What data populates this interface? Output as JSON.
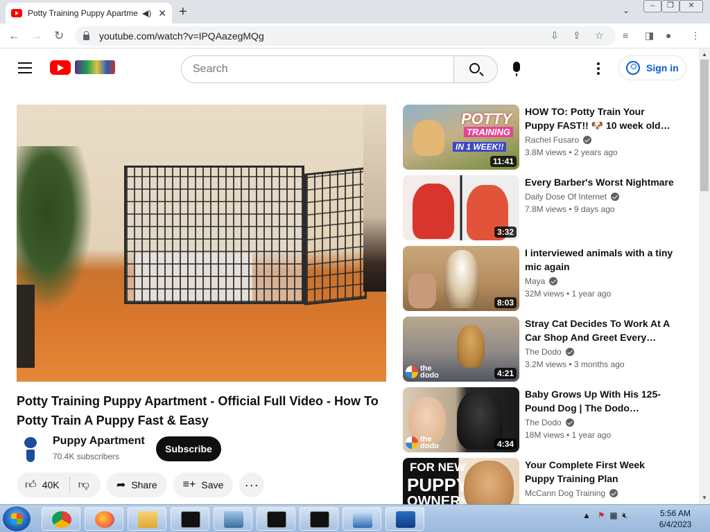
{
  "browser": {
    "tab_title": "Potty Training Puppy Apartment",
    "url": "youtube.com/watch?v=IPQAazegMQg"
  },
  "header": {
    "search_placeholder": "Search",
    "signin_label": "Sign in"
  },
  "video": {
    "title": "Potty Training Puppy Apartment - Official Full Video - How To Potty Train A Puppy Fast & Easy",
    "channel": "Puppy Apartment",
    "subscribers": "70.4K subscribers",
    "subscribe_label": "Subscribe",
    "likes": "40K",
    "share_label": "Share",
    "save_label": "Save"
  },
  "recommendations": [
    {
      "title": "HOW TO: Potty Train Your Puppy FAST!! 🐶 10 week old…",
      "channel": "Rachel Fusaro",
      "meta": "3.8M views • 2 years ago",
      "duration": "11:41",
      "thumb_caption_1": "POTTY",
      "thumb_caption_2": "TRAINING",
      "thumb_caption_3": "IN 1 WEEK!!"
    },
    {
      "title": "Every Barber's Worst Nightmare",
      "channel": "Daily Dose Of Internet",
      "meta": "7.8M views • 9 days ago",
      "duration": "3:32"
    },
    {
      "title": "I interviewed animals with a tiny mic again",
      "channel": "Maya",
      "meta": "32M views • 1 year ago",
      "duration": "8:03"
    },
    {
      "title": "Stray Cat Decides To Work At A Car Shop And Greet Every…",
      "channel": "The Dodo",
      "meta": "3.2M views • 3 months ago",
      "duration": "4:21",
      "badge": "the dodo"
    },
    {
      "title": "Baby Grows Up With His 125-Pound Dog | The Dodo…",
      "channel": "The Dodo",
      "meta": "18M views • 1 year ago",
      "duration": "4:34",
      "badge": "the dodo"
    },
    {
      "title": "Your Complete First Week Puppy Training Plan",
      "channel": "McCann Dog Training",
      "meta": "",
      "duration": "",
      "thumb_caption_1": "FOR NEW",
      "thumb_caption_2": "PUPPY",
      "thumb_caption_3": "OWNERS"
    }
  ],
  "taskbar": {
    "time": "5:56 AM",
    "date": "6/4/2023"
  },
  "colors": {
    "youtube_red": "#ff0000",
    "link_blue": "#065fd4"
  }
}
